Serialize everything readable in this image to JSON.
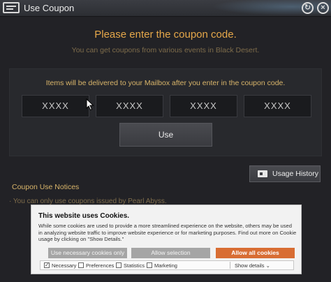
{
  "window": {
    "title": "Use Coupon"
  },
  "main": {
    "heading": "Please enter the coupon code.",
    "subheading": "You can get coupons from various events in Black Desert."
  },
  "panel": {
    "note": "Items will be delivered to your Mailbox after you enter in the coupon code.",
    "inputs": [
      {
        "placeholder": "XXXX"
      },
      {
        "placeholder": "XXXX"
      },
      {
        "placeholder": "XXXX"
      },
      {
        "placeholder": "XXXX"
      }
    ],
    "use_label": "Use"
  },
  "history": {
    "label": "Usage History"
  },
  "notices": {
    "title": "Coupon Use Notices",
    "items": [
      "· You can only use coupons issued by Pearl Abyss."
    ]
  },
  "cookie": {
    "title": "This website uses Cookies.",
    "body": "While some cookies are used to provide a more streamlined experience on the website, others may be used in analyzing website traffic to improve website experience or for marketing purposes. Find out more on Cookie usage by clicking on \"Show Details.\"",
    "buttons": {
      "necessary": "Use necessary cookies only",
      "selection": "Allow selection",
      "all": "Allow all cookies"
    },
    "options": [
      {
        "label": "Necessary",
        "checked": true
      },
      {
        "label": "Preferences",
        "checked": false
      },
      {
        "label": "Statistics",
        "checked": false
      },
      {
        "label": "Marketing",
        "checked": false
      }
    ],
    "show_details": "Show details",
    "accent": "#d86d33"
  },
  "icons": [
    "coupon-icon",
    "refresh-icon",
    "close-icon",
    "ticket-icon",
    "chevron-down-icon"
  ]
}
